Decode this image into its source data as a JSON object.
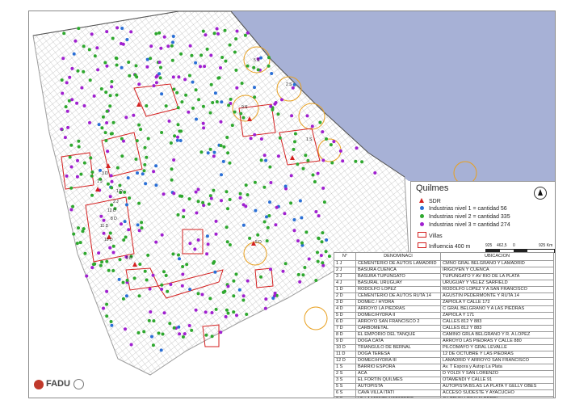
{
  "legend": {
    "title": "Quilmes",
    "items": [
      {
        "label": "SDR",
        "symbol": "triangle",
        "color": "#d42020"
      },
      {
        "label": "Industrias  nivel 1 = cantidad 56",
        "symbol": "dot",
        "color": "#2a6fd6"
      },
      {
        "label": "Industrias nivel 2 = cantidad 335",
        "symbol": "dot",
        "color": "#2ea82e"
      },
      {
        "label": "Industrias nivel 3 = cantidad 274",
        "symbol": "dot",
        "color": "#a020d0"
      },
      {
        "label": "Villas",
        "symbol": "box",
        "color": "#d42020"
      },
      {
        "label": "Influencia 400 m",
        "symbol": "box-outline",
        "color": "#d42020"
      }
    ],
    "scale": {
      "ticks": [
        "925",
        "462,5",
        "0",
        "925 Km"
      ]
    }
  },
  "map_labels": [
    "5 S",
    "2 S",
    "9 S",
    "1 S",
    "3 D",
    "1 J",
    "1 D",
    "2 J",
    "12 D",
    "8 D",
    "11 D",
    "10 D",
    "9 D",
    "5 D"
  ],
  "table": {
    "headers": [
      "N°",
      "DENOMINACI",
      "UBICACION"
    ],
    "rows": [
      [
        "1 J",
        "CEMENTERIO DE AUTOS LAMADRID",
        "CMNO GRAL BELGRANO Y LAMADRID"
      ],
      [
        "2 J",
        "BASURA CUENCA",
        "IRIGOYEN Y CUENCA"
      ],
      [
        "3 J",
        "BASURA  TUPUNGATO",
        "TUPUNGATO Y AV RIO DE LA PLATA"
      ],
      [
        "4 J",
        "BASURAL URUGUAY",
        "URUGUAY Y VELEZ SARFIELD"
      ],
      [
        "1 D",
        "RODOLFO LOPEZ",
        "RODOLFO LOPEZ Y A SAN FRANCISCO"
      ],
      [
        "2 D",
        "CEMENTERIO DE AUTOS RUTA 14",
        "AGUSTIN PEDERMONTE Y RUTA 14"
      ],
      [
        "3 D",
        "DOMEC / HYDRA",
        "ZAPIOLA Y CALLE 172"
      ],
      [
        "4 D",
        "ARROYO LA PIEDRAS",
        "C GRAL BELGRANO Y A LAS PIEDRAS"
      ],
      [
        "5 D",
        "DOMEC/HYDRA II",
        "ZAPIOLA Y 171"
      ],
      [
        "6 D",
        "ARROYO SAN FRANCISCO 2",
        "CALLES 812 Y 883"
      ],
      [
        "7 D",
        "CARBOMETAL",
        "CALLES 812 Y 883"
      ],
      [
        "8 D",
        "EL EMPORIO DEL TANQUE",
        "CAMINO GRLA BELGRANO Y R. A LOPEZ"
      ],
      [
        "9 D",
        "DOGA CATA",
        "ARROYO LAS PIEDRAS Y CALLE 880"
      ],
      [
        "10 D",
        "TRIANGULO DE BERNAL",
        "PILCOMAYO Y GRAL LEVALLE"
      ],
      [
        "11 D",
        "DOGA TERESA",
        "12 DE OCTUBRE Y LAS PIEDRAS"
      ],
      [
        "12 D",
        "DOMEC/HYDRA III",
        "LAMADRID Y ARROYO SAN FRANCISCO"
      ],
      [
        "1 S",
        "BARRIO ESPORA",
        "Av. T Espora y Autop La Plata"
      ],
      [
        "2 S",
        "ACA",
        "D YOLDI Y SAN LORENZO"
      ],
      [
        "3 S",
        "EL FORTIN QUILMES",
        "OTAMENDI Y CALLE 91"
      ],
      [
        "5 S",
        "AUTOPISTA",
        "AUTOPISTA BS.AS LA PLATA Y GELLY OBES"
      ],
      [
        "6 S",
        "CAVA VILLA ITATI",
        "ACCESO SUDESTE Y AYACUCHO"
      ],
      [
        "9 S",
        "VILLA MONTE MATADERO",
        "AV CEVALLOS Y ALBERDI"
      ]
    ]
  },
  "logo": {
    "text": "FADU"
  },
  "colors": {
    "water": "#a7b1d6",
    "street": "#cfcfcf",
    "outline": "#d42020",
    "influence": "#e8a020"
  }
}
